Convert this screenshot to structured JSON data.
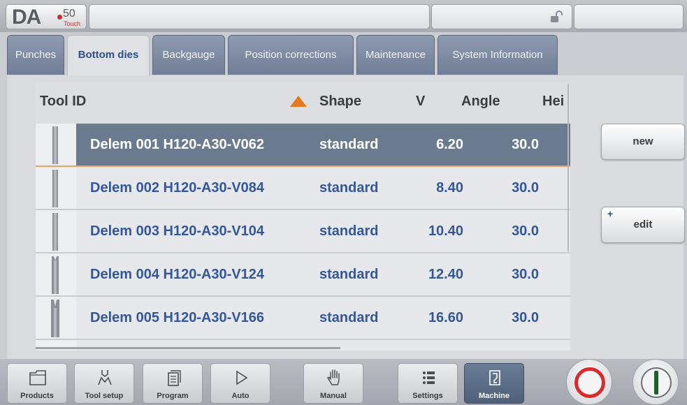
{
  "app": {
    "logo_text": "DA",
    "logo_model": "50",
    "logo_sub": "Touch"
  },
  "tabs": [
    {
      "label": "Punches",
      "active": false
    },
    {
      "label": "Bottom dies",
      "active": true
    },
    {
      "label": "Backgauge",
      "active": false
    },
    {
      "label": "Position corrections",
      "active": false
    },
    {
      "label": "Maintenance",
      "active": false
    },
    {
      "label": "System Information",
      "active": false
    }
  ],
  "table": {
    "columns": [
      "Tool ID",
      "Shape",
      "V",
      "Angle",
      "Hei"
    ],
    "sort_column": "Tool ID",
    "sort_direction": "ascending",
    "rows": [
      {
        "id": "Delem 001 H120-A30-V062",
        "shape": "standard",
        "v": "6.20",
        "angle": "30.0",
        "selected": true
      },
      {
        "id": "Delem 002 H120-A30-V084",
        "shape": "standard",
        "v": "8.40",
        "angle": "30.0",
        "selected": false
      },
      {
        "id": "Delem 003 H120-A30-V104",
        "shape": "standard",
        "v": "10.40",
        "angle": "30.0",
        "selected": false
      },
      {
        "id": "Delem 004 H120-A30-V124",
        "shape": "standard",
        "v": "12.40",
        "angle": "30.0",
        "selected": false
      },
      {
        "id": "Delem 005 H120-A30-V166",
        "shape": "standard",
        "v": "16.60",
        "angle": "30.0",
        "selected": false
      }
    ]
  },
  "side_buttons": {
    "new_label": "new",
    "edit_label": "edit",
    "edit_prefix": "+"
  },
  "bottom_nav": [
    {
      "label": "Products",
      "icon": "folder-icon",
      "active": false
    },
    {
      "label": "Tool setup",
      "icon": "tool-setup-icon",
      "active": false
    },
    {
      "label": "Program",
      "icon": "program-icon",
      "active": false
    },
    {
      "label": "Auto",
      "icon": "play-icon",
      "active": false
    },
    {
      "label": "Manual",
      "icon": "hand-icon",
      "active": false
    },
    {
      "label": "Settings",
      "icon": "settings-list-icon",
      "active": false
    },
    {
      "label": "Machine",
      "icon": "machine-icon",
      "active": true
    }
  ],
  "colors": {
    "accent_tab": "#2d4f89",
    "row_text": "#34579a",
    "selected_row": "#6b7b8f",
    "sort_arrow": "#e8781e",
    "stop": "#d92b2b",
    "start": "#1f5e2d"
  }
}
